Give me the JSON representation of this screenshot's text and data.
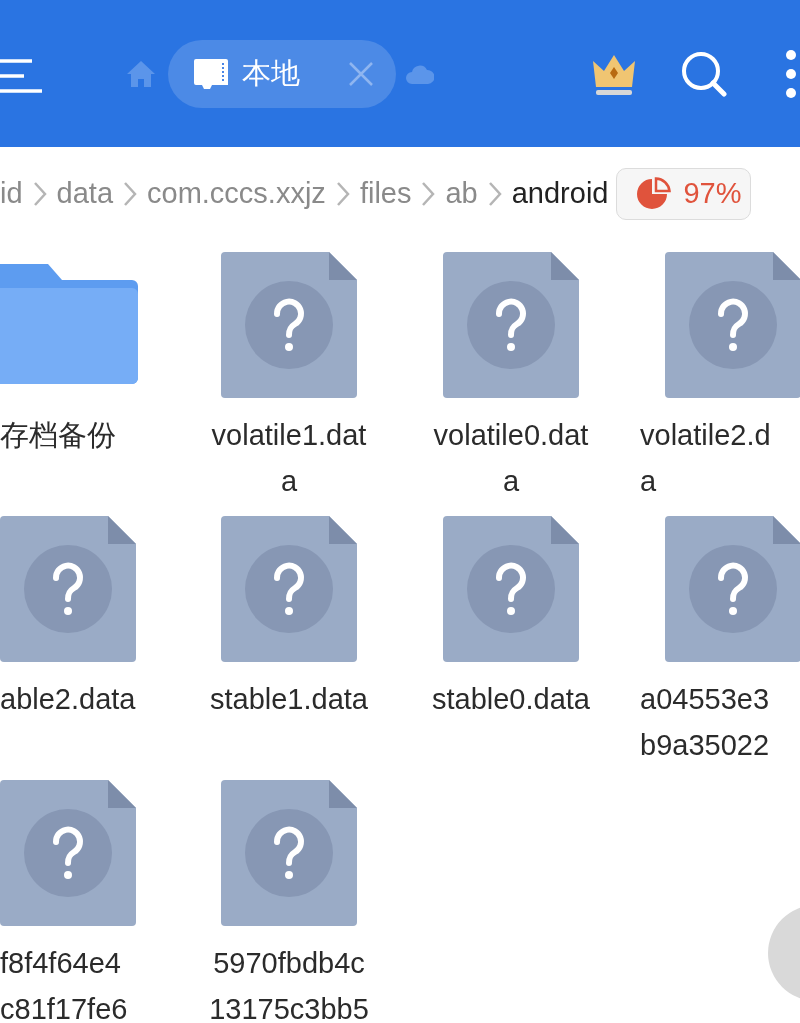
{
  "toolbar": {
    "tabs": [
      {
        "label": "本地",
        "selected": true
      }
    ]
  },
  "breadcrumb": [
    {
      "label": "id",
      "current": false
    },
    {
      "label": "data",
      "current": false
    },
    {
      "label": "com.cccs.xxjz",
      "current": false
    },
    {
      "label": "files",
      "current": false
    },
    {
      "label": "ab",
      "current": false
    },
    {
      "label": "android",
      "current": true
    }
  ],
  "storage": {
    "reading": "97%"
  },
  "files": [
    {
      "kind": "folder",
      "lines": [
        "存档备份"
      ]
    },
    {
      "kind": "file",
      "lines": [
        "volatile1.dat",
        "a"
      ]
    },
    {
      "kind": "file",
      "lines": [
        "volatile0.dat",
        "a"
      ]
    },
    {
      "kind": "file",
      "lines": [
        "volatile2.d",
        "a"
      ]
    },
    {
      "kind": "file",
      "lines": [
        "able2.data"
      ]
    },
    {
      "kind": "file",
      "lines": [
        "stable1.data"
      ]
    },
    {
      "kind": "file",
      "lines": [
        "stable0.data"
      ]
    },
    {
      "kind": "file",
      "lines": [
        "a04553e3",
        "b9a35022"
      ]
    },
    {
      "kind": "file",
      "lines": [
        "f8f4f64e4",
        "c81f17fe6"
      ]
    },
    {
      "kind": "file",
      "lines": [
        "5970fbdb4c",
        "13175c3bb5"
      ]
    }
  ]
}
